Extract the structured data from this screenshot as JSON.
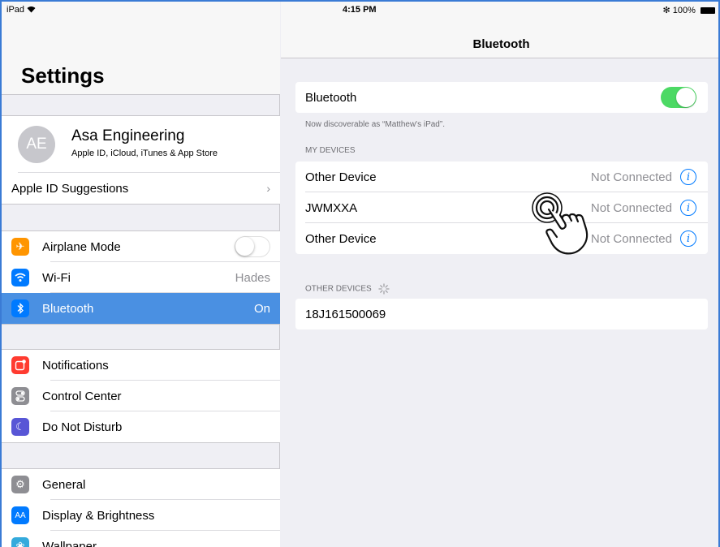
{
  "status_bar": {
    "device": "iPad",
    "time": "4:15 PM",
    "battery": "100%"
  },
  "sidebar": {
    "title": "Settings",
    "profile": {
      "initials": "AE",
      "name": "Asa Engineering",
      "subtitle": "Apple ID, iCloud, iTunes & App Store"
    },
    "suggestions": "Apple ID Suggestions",
    "connectivity": [
      {
        "label": "Airplane Mode",
        "value": "",
        "icon": "airplane-icon",
        "color": "#ff9500"
      },
      {
        "label": "Wi-Fi",
        "value": "Hades",
        "icon": "wifi-icon",
        "color": "#007aff"
      },
      {
        "label": "Bluetooth",
        "value": "On",
        "icon": "bluetooth-icon",
        "color": "#007aff"
      }
    ],
    "system": [
      {
        "label": "Notifications",
        "icon": "notifications-icon",
        "color": "#ff3b30"
      },
      {
        "label": "Control Center",
        "icon": "control-center-icon",
        "color": "#8e8e93"
      },
      {
        "label": "Do Not Disturb",
        "icon": "moon-icon",
        "color": "#5856d6"
      }
    ],
    "general": [
      {
        "label": "General",
        "icon": "gear-icon",
        "color": "#8e8e93"
      },
      {
        "label": "Display & Brightness",
        "icon": "display-icon",
        "color": "#007aff"
      },
      {
        "label": "Wallpaper",
        "icon": "wallpaper-icon",
        "color": "#34aadc"
      }
    ]
  },
  "detail": {
    "title": "Bluetooth",
    "toggle_label": "Bluetooth",
    "discoverable": "Now discoverable as “Matthew's iPad”.",
    "my_devices_header": "MY DEVICES",
    "my_devices": [
      {
        "name": "Other Device",
        "status": "Not Connected"
      },
      {
        "name": "JWMXXA",
        "status": "Not Connected"
      },
      {
        "name": "Other Device",
        "status": "Not Connected"
      }
    ],
    "other_devices_header": "OTHER DEVICES",
    "other_devices": [
      {
        "name": "18J161500069"
      }
    ]
  },
  "colors": {
    "accent": "#007aff",
    "selected_row": "#4a90e2",
    "toggle_on": "#4cd964"
  }
}
